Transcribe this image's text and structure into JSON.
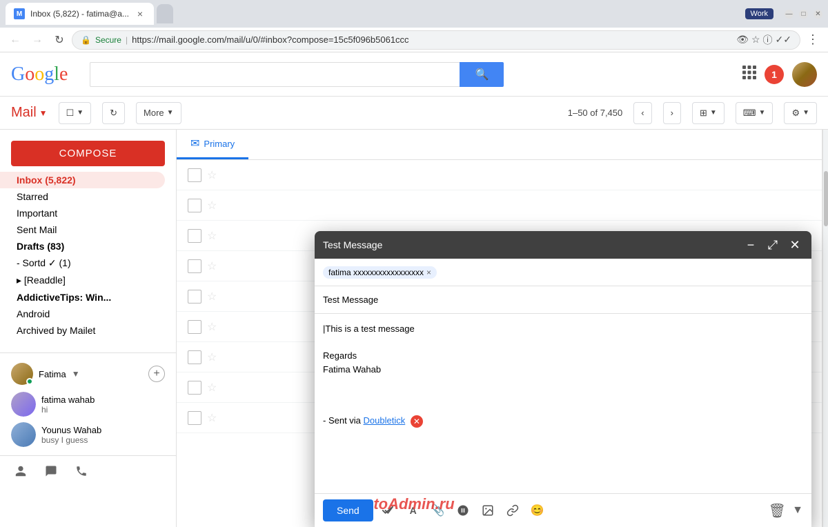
{
  "window": {
    "work_badge": "Work",
    "minimize": "—",
    "maximize": "□",
    "close": "✕"
  },
  "chrome": {
    "tab_title": "Inbox (5,822) - fatima@a...",
    "tab_close": "×",
    "back": "←",
    "forward": "→",
    "reload": "↻",
    "secure_label": "Secure",
    "url": "https://mail.google.com/mail/u/0/#inbox?compose=15c5f096b5061ccc",
    "search_placeholder": ""
  },
  "google_header": {
    "logo": "Google",
    "search_btn_label": "🔍",
    "apps_icon": "⋮⋮⋮",
    "notification_count": "1"
  },
  "mail_header": {
    "label": "Mail",
    "dropdown_icon": "▼",
    "select_label": "☐",
    "refresh_label": "↻",
    "more_label": "More",
    "more_dropdown": "▼",
    "pagination": "1–50 of 7,450",
    "prev": "‹",
    "next": "›",
    "split_view": "⊞",
    "keyboard": "⌨",
    "settings": "⚙"
  },
  "sidebar": {
    "compose_label": "COMPOSE",
    "items": [
      {
        "label": "Inbox (5,822)",
        "active": true,
        "count": ""
      },
      {
        "label": "Starred",
        "active": false
      },
      {
        "label": "Important",
        "active": false
      },
      {
        "label": "Sent Mail",
        "active": false
      },
      {
        "label": "Drafts (83)",
        "active": false,
        "bold": true
      },
      {
        "label": "- Sortd ✓ (1)",
        "active": false
      },
      {
        "label": "▸ [Readdle]",
        "active": false
      },
      {
        "label": "AddictiveTips: Win...",
        "active": false,
        "bold": true
      },
      {
        "label": "Android",
        "active": false
      },
      {
        "label": "Archived by Mailet",
        "active": false
      }
    ],
    "chat_user": "Fatima",
    "chat_dropdown": "▼",
    "add_chat": "+",
    "contacts": [
      {
        "name": "fatima wahab",
        "msg": "hi"
      },
      {
        "name": "Younus Wahab",
        "msg": "busy I guess"
      }
    ],
    "bottom_icons": [
      "👤",
      "💬",
      "📞"
    ]
  },
  "email_tabs": [
    {
      "label": "Primary",
      "icon": "✉",
      "active": true
    }
  ],
  "compose": {
    "title": "Test Message",
    "to_label": "",
    "to_email": "fatima xxxxxxxxxxxxxxxxx",
    "subject": "Test Message",
    "body_line1": "This is a test message",
    "body_line2": "",
    "regards": "Regards",
    "signature_name": "Fatima Wahab",
    "signature_link": "Doubletick",
    "signature_text": "- Sent via ",
    "send_label": "Send",
    "minimize": "−",
    "expand": "⤢",
    "close": "✕"
  }
}
